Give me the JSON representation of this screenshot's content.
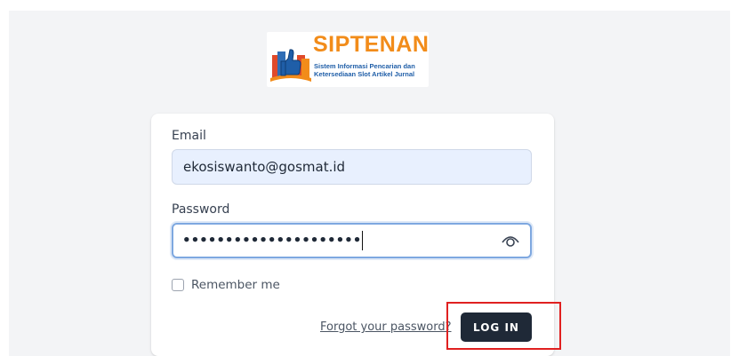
{
  "brand": {
    "title": "SIPTENAN",
    "subtitle_line1": "Sistem Informasi Pencarian dan",
    "subtitle_line2": "Ketersediaan Slot Artikel Jurnal",
    "title_color": "#f28c1a",
    "subtitle_color": "#1f5ea8",
    "logo_icon": "thumbs-up-books-icon"
  },
  "form": {
    "email_label": "Email",
    "email_value": "ekosiswanto@gosmat.id",
    "password_label": "Password",
    "password_masked": "•••••••••••••••••••••",
    "password_toggle_icon": "eye-icon",
    "remember_label": "Remember me",
    "remember_checked": false,
    "forgot_link": "Forgot your password?",
    "login_button": "LOG IN"
  },
  "colors": {
    "background": "#f3f4f6",
    "button": "#1f2937",
    "highlight": "#e02020"
  }
}
